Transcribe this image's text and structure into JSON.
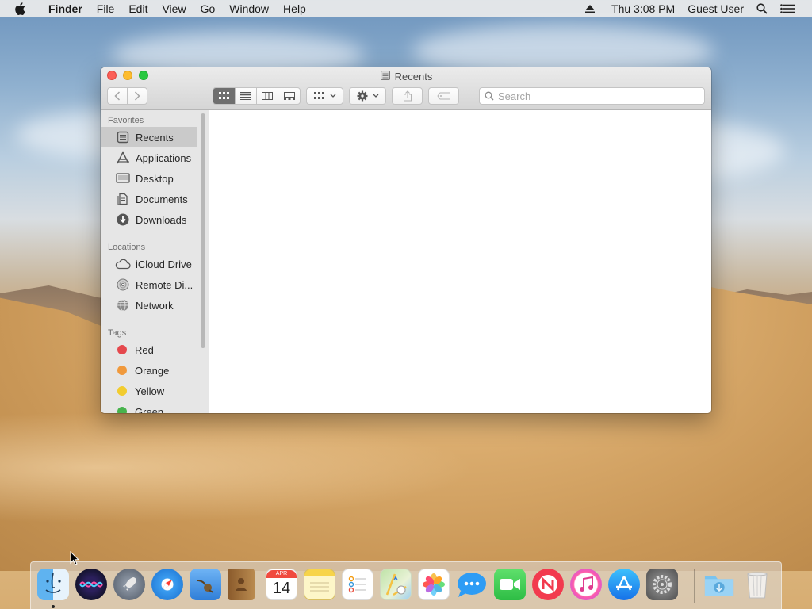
{
  "menubar": {
    "app_name": "Finder",
    "menus": [
      "File",
      "Edit",
      "View",
      "Go",
      "Window",
      "Help"
    ],
    "clock": "Thu 3:08 PM",
    "user": "Guest User"
  },
  "window": {
    "title": "Recents",
    "search_placeholder": "Search"
  },
  "sidebar": {
    "sections": [
      {
        "heading": "Favorites",
        "items": [
          {
            "label": "Recents",
            "icon": "recents-icon",
            "selected": true
          },
          {
            "label": "Applications",
            "icon": "applications-icon"
          },
          {
            "label": "Desktop",
            "icon": "desktop-icon"
          },
          {
            "label": "Documents",
            "icon": "documents-icon"
          },
          {
            "label": "Downloads",
            "icon": "downloads-icon"
          }
        ]
      },
      {
        "heading": "Locations",
        "items": [
          {
            "label": "iCloud Drive",
            "icon": "cloud-icon"
          },
          {
            "label": "Remote Di...",
            "icon": "disc-icon"
          },
          {
            "label": "Network",
            "icon": "network-icon"
          }
        ]
      },
      {
        "heading": "Tags",
        "items": [
          {
            "label": "Red",
            "color": "#e5484d"
          },
          {
            "label": "Orange",
            "color": "#f0993c"
          },
          {
            "label": "Yellow",
            "color": "#f2cc2f"
          },
          {
            "label": "Green",
            "color": "#47b34c"
          }
        ]
      }
    ]
  },
  "dock": {
    "calendar_month": "APR",
    "calendar_day": "14",
    "apps": [
      "finder-icon",
      "siri-icon",
      "launchpad-icon",
      "safari-icon",
      "mail-icon",
      "contacts-icon",
      "calendar-icon",
      "notes-icon",
      "reminders-icon",
      "maps-icon",
      "photos-icon",
      "messages-icon",
      "facetime-icon",
      "news-icon",
      "itunes-icon",
      "app-store-icon",
      "system-preferences-icon",
      "downloads-folder-icon",
      "trash-icon"
    ]
  }
}
